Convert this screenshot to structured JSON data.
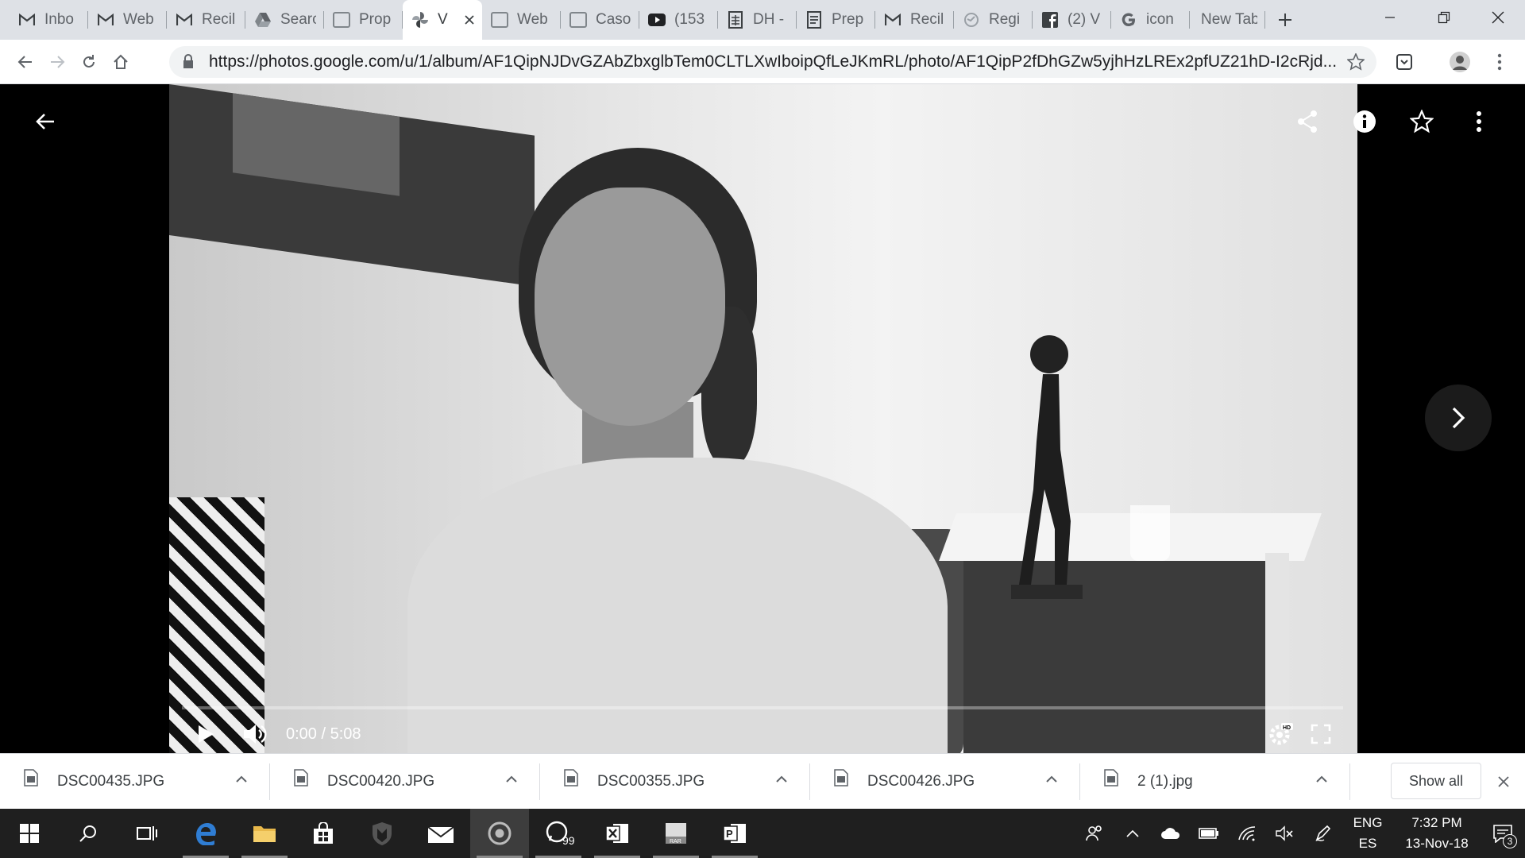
{
  "browser": {
    "tabs": [
      {
        "title": "Inbo",
        "icon": "gmail-icon"
      },
      {
        "title": "Web",
        "icon": "gmail-icon"
      },
      {
        "title": "Recil",
        "icon": "gmail-icon"
      },
      {
        "title": "Searc",
        "icon": "drive-icon"
      },
      {
        "title": "Prop",
        "icon": "page-icon"
      },
      {
        "title": "V",
        "icon": "google-photos-icon",
        "active": true
      },
      {
        "title": "Web",
        "icon": "page-icon"
      },
      {
        "title": "Caso",
        "icon": "page-icon"
      },
      {
        "title": "(153",
        "icon": "youtube-icon"
      },
      {
        "title": "DH -",
        "icon": "sheets-icon"
      },
      {
        "title": "Prep",
        "icon": "docs-icon"
      },
      {
        "title": "Recil",
        "icon": "gmail-icon"
      },
      {
        "title": "Regi",
        "icon": "globe-icon"
      },
      {
        "title": "(2) V",
        "icon": "facebook-icon"
      },
      {
        "title": "icon",
        "icon": "google-icon"
      },
      {
        "title": "New Tab",
        "icon": ""
      }
    ],
    "url": {
      "host": "https://photos.google.com",
      "path": "/u/1/album/AF1QipNJDvGZAbZbxglbTem0CLTLXwIboipQfLeJKmRL/photo/AF1QipP2fDhGZw5yjhHzLREx2pfUZ21hD-I2cRjd..."
    }
  },
  "video": {
    "current_time": "0:00",
    "duration": "5:08",
    "timecode": "0:00 / 5:08",
    "progress": 0.0
  },
  "downloads": [
    {
      "name": "DSC00435.JPG"
    },
    {
      "name": "DSC00420.JPG"
    },
    {
      "name": "DSC00355.JPG"
    },
    {
      "name": "DSC00426.JPG"
    },
    {
      "name": "2 (1).jpg"
    }
  ],
  "shelf": {
    "show_all": "Show all"
  },
  "taskbar": {
    "lang_top": "ENG",
    "lang_bottom": "ES",
    "time": "7:32 PM",
    "date": "13-Nov-18",
    "notifications": "3",
    "whatsapp_badge": "99"
  }
}
